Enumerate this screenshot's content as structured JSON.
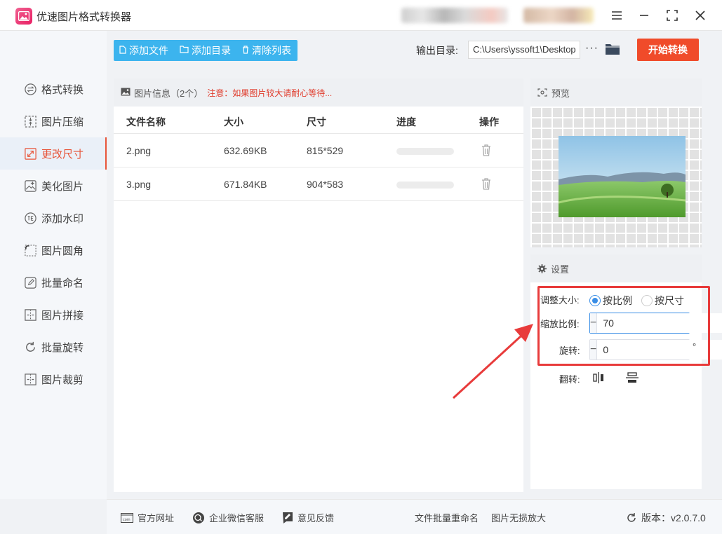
{
  "app": {
    "title": "优速图片格式转换器"
  },
  "sidebar": {
    "items": [
      {
        "label": "格式转换",
        "icon": "format-convert-icon"
      },
      {
        "label": "图片压缩",
        "icon": "compress-icon"
      },
      {
        "label": "更改尺寸",
        "icon": "resize-icon",
        "active": true
      },
      {
        "label": "美化图片",
        "icon": "beautify-icon"
      },
      {
        "label": "添加水印",
        "icon": "watermark-icon"
      },
      {
        "label": "图片圆角",
        "icon": "rounded-corner-icon"
      },
      {
        "label": "批量命名",
        "icon": "rename-icon"
      },
      {
        "label": "图片拼接",
        "icon": "stitch-icon"
      },
      {
        "label": "批量旋转",
        "icon": "rotate-icon"
      },
      {
        "label": "图片裁剪",
        "icon": "crop-icon"
      }
    ]
  },
  "toolbar": {
    "add_file": "添加文件",
    "add_dir": "添加目录",
    "clear_list": "清除列表",
    "output_dir_label": "输出目录:",
    "output_dir_value": "C:\\Users\\yssoft1\\Desktop",
    "more": "···",
    "start": "开始转换"
  },
  "file_panel": {
    "title": "图片信息（2个）",
    "warning": "注意：如果图片较大请耐心等待...",
    "columns": [
      "文件名称",
      "大小",
      "尺寸",
      "进度",
      "操作"
    ],
    "rows": [
      {
        "name": "2.png",
        "size": "632.69KB",
        "dims": "815*529",
        "progress": 0
      },
      {
        "name": "3.png",
        "size": "671.84KB",
        "dims": "904*583",
        "progress": 0
      }
    ]
  },
  "preview": {
    "title": "预览"
  },
  "settings": {
    "title": "设置",
    "resize_label": "调整大小:",
    "by_ratio": "按比例",
    "by_size": "按尺寸",
    "selected": "by_ratio",
    "scale_label": "缩放比例:",
    "scale_value": "70",
    "rotate_label": "旋转:",
    "rotate_value": "0",
    "degree_unit": "°",
    "flip_label": "翻转:",
    "minus": "−",
    "plus": "+"
  },
  "footer": {
    "website": "官方网址",
    "wechat": "企业微信客服",
    "feedback": "意见反馈",
    "batch_rename": "文件批量重命名",
    "lossless": "图片无损放大",
    "version": "版本：v2.0.7.0"
  },
  "colors": {
    "accent": "#3cb4ee",
    "start_button": "#f04b2a",
    "active_nav": "#e8553a",
    "highlight": "#e83b3b"
  }
}
